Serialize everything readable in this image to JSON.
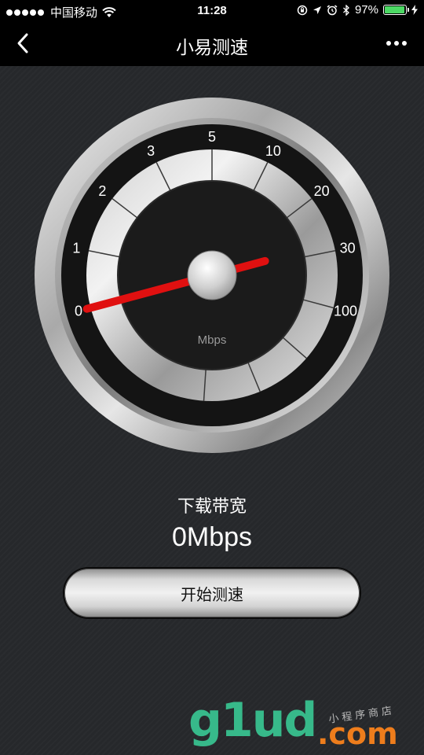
{
  "status_bar": {
    "carrier": "中国移动",
    "time": "11:28",
    "battery_percent_text": "97%",
    "battery_level": 0.97,
    "battery_color": "#4cd964",
    "icons": [
      "signal-dots-icon",
      "wifi-icon",
      "orientation-lock-icon",
      "location-arrow-icon",
      "alarm-icon",
      "bluetooth-icon",
      "battery-icon",
      "charging-bolt-icon"
    ]
  },
  "nav": {
    "title": "小易测速",
    "back_icon": "chevron-left-icon",
    "more_icon": "more-dots-icon"
  },
  "gauge": {
    "unit": "Mbps",
    "scale_labels": [
      "0",
      "1",
      "2",
      "3",
      "5",
      "10",
      "20",
      "30",
      "100"
    ],
    "current_value": 0,
    "needle_color": "#e01010"
  },
  "result": {
    "title": "下载带宽",
    "value": "0Mbps"
  },
  "actions": {
    "start_label": "开始测速"
  },
  "watermark": {
    "logo": "g1ud",
    "dotcom": ".com",
    "tagline": "小程序商店",
    "logo_color": "#37b98a",
    "dotcom_color": "#ee7d1c"
  }
}
